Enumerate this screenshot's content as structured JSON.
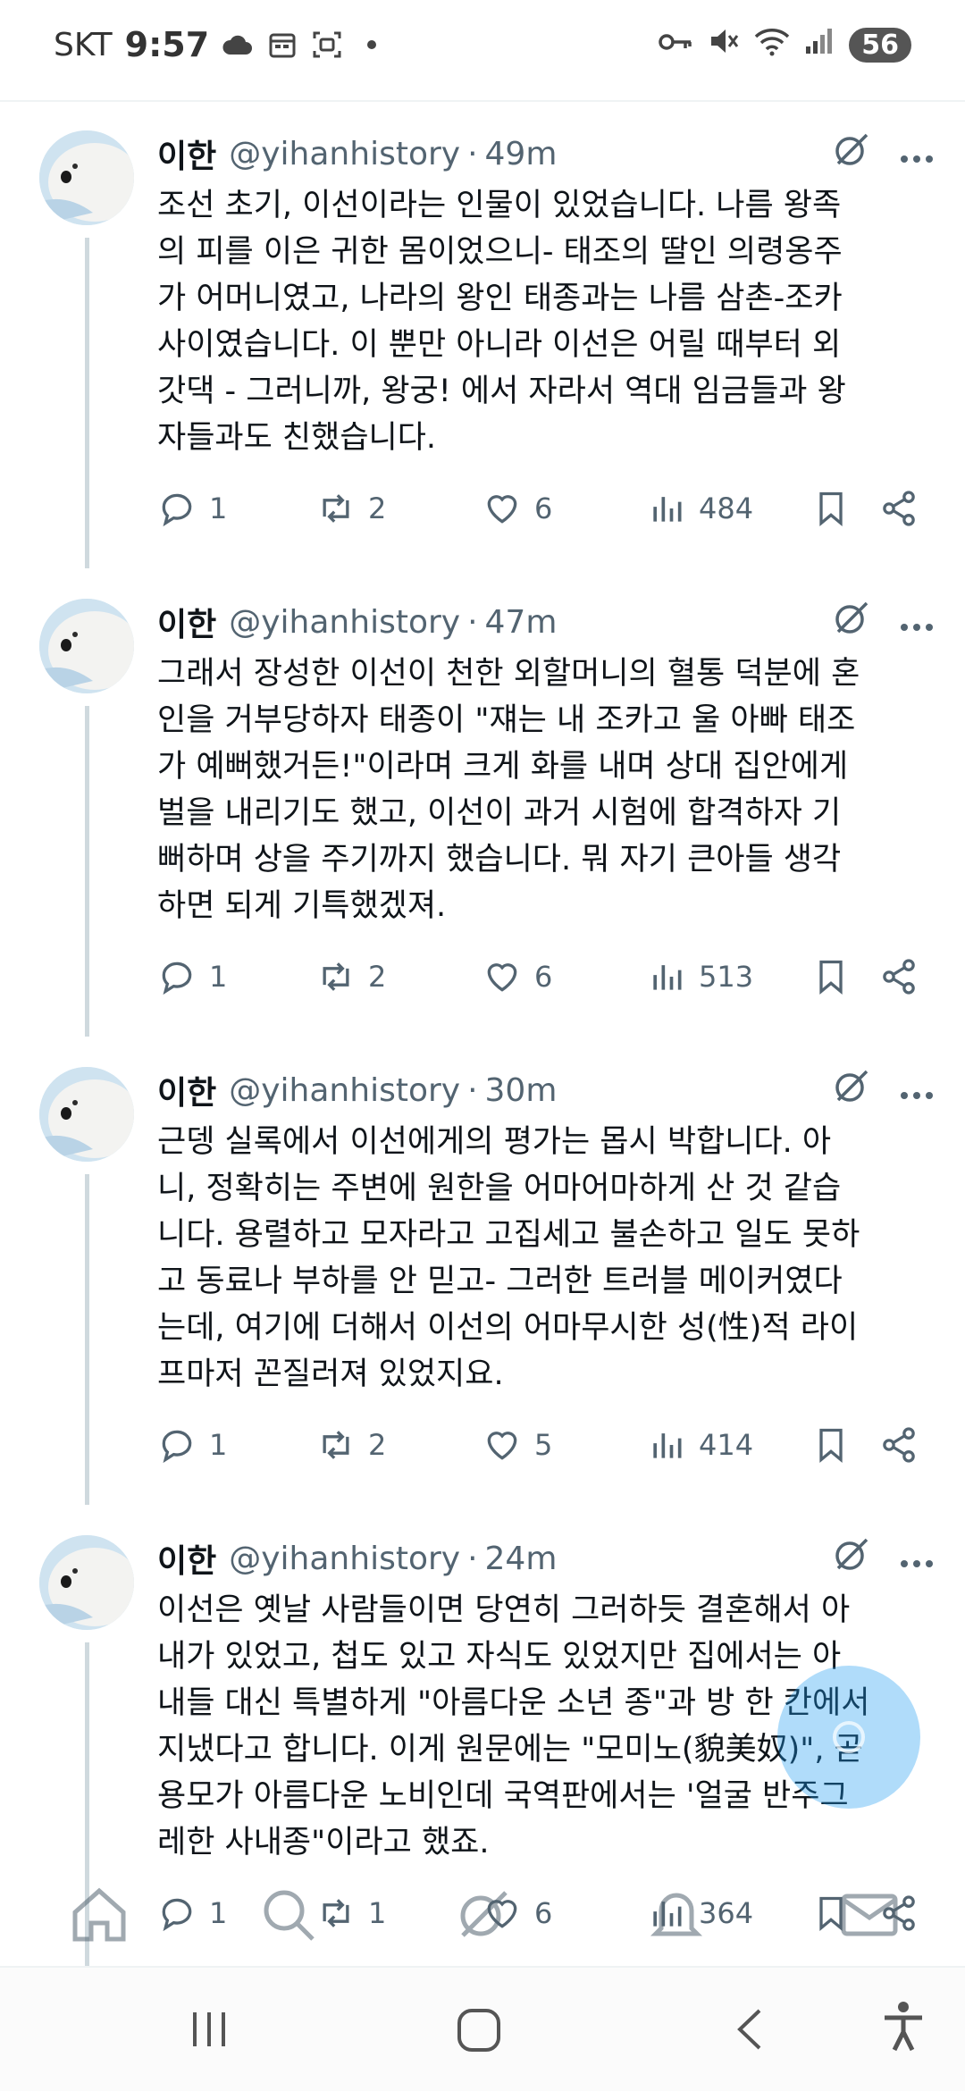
{
  "status_bar": {
    "carrier": "SKT",
    "time": "9:57",
    "battery": "56"
  },
  "tweets": [
    {
      "name": "이한",
      "handle": "@yihanhistory",
      "separator": "·",
      "time": "49m",
      "text": "조선 초기, 이선이라는 인물이 있었습니다. 나름 왕족\n의 피를 이은 귀한 몸이었으니- 태조의 딸인 의령옹주\n가 어머니였고, 나라의 왕인 태종과는 나름 삼촌-조카\n사이였습니다. 이 뿐만 아니라 이선은 어릴 때부터 외\n갓댁 - 그러니까, 왕궁! 에서 자라서 역대 임금들과 왕\n자들과도 친했습니다.",
      "replies": "1",
      "retweets": "2",
      "likes": "6",
      "views": "484"
    },
    {
      "name": "이한",
      "handle": "@yihanhistory",
      "separator": "·",
      "time": "47m",
      "text": "그래서 장성한 이선이 천한 외할머니의 혈통 덕분에 혼\n인을 거부당하자 태종이 \"쟤는 내 조카고 울 아빠 태조\n가 예뻐했거든!\"이라며 크게 화를 내며 상대 집안에게\n벌을 내리기도 했고, 이선이 과거 시험에 합격하자 기\n뻐하며 상을 주기까지 했습니다. 뭐 자기 큰아들 생각\n하면 되게 기특했겠져.",
      "replies": "1",
      "retweets": "2",
      "likes": "6",
      "views": "513"
    },
    {
      "name": "이한",
      "handle": "@yihanhistory",
      "separator": "·",
      "time": "30m",
      "text": "근뎅 실록에서 이선에게의 평가는 몹시 박합니다. 아\n니, 정확히는 주변에 원한을 어마어마하게 산 것 같습\n니다. 용렬하고 모자라고 고집세고 불손하고 일도 못하\n고 동료나 부하를 안 믿고- 그러한 트러블 메이커였다\n는데, 여기에 더해서 이선의 어마무시한 성(性)적 라이\n프마저 꼰질러져 있었지요.",
      "replies": "1",
      "retweets": "2",
      "likes": "5",
      "views": "414"
    },
    {
      "name": "이한",
      "handle": "@yihanhistory",
      "separator": "·",
      "time": "24m",
      "text": "이선은 옛날 사람들이면 당연히 그러하듯 결혼해서 아\n내가 있었고, 첩도 있고 자식도 있었지만 집에서는 아\n내들 대신 특별하게 \"아름다운 소년 종\"과 방 한 칸에서\n지냈다고 합니다. 이게 원문에는 \"모미노(貌美奴)\", 곧\n용모가 아름다운 노비인데 국역판에서는 '얼굴 반주그\n레한 사내종\"이라고 했죠.",
      "replies": "1",
      "retweets": "1",
      "likes": "6",
      "views": "364"
    }
  ],
  "icons": {
    "reply": "reply-icon",
    "retweet": "retweet-icon",
    "like": "heart-icon",
    "views": "views-icon",
    "bookmark": "bookmark-icon",
    "share": "share-icon",
    "grok": "grok-icon",
    "more": "more-icon"
  },
  "colors": {
    "text": "#0f1419",
    "muted": "#536471",
    "accent": "#1d9bf0"
  }
}
